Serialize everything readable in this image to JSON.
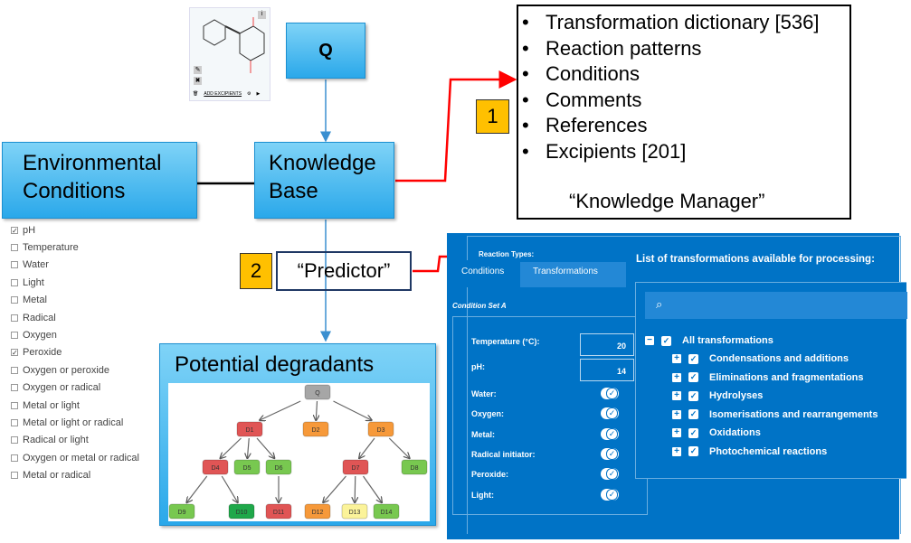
{
  "molecule": {
    "add_excipients": "ADD EXCIPIENTS",
    "icons": [
      "info-icon",
      "edit-icon",
      "close-icon",
      "trash-icon",
      "gear-icon",
      "play-icon"
    ]
  },
  "nodes": {
    "q": "Q",
    "env": "Environmental Conditions",
    "kb": "Knowledge Base",
    "predictor": "“Predictor”",
    "degradants": "Potential degradants"
  },
  "tags": {
    "one": "1",
    "two": "2"
  },
  "knowledge_manager": {
    "items": [
      "Transformation dictionary [536]",
      "Reaction patterns",
      "Conditions",
      "Comments",
      "References",
      "Excipients [201]"
    ],
    "caption": "“Knowledge Manager”"
  },
  "conditions_list": [
    {
      "label": "pH",
      "checked": true
    },
    {
      "label": "Temperature",
      "checked": false
    },
    {
      "label": "Water",
      "checked": false
    },
    {
      "label": "Light",
      "checked": false
    },
    {
      "label": "Metal",
      "checked": false
    },
    {
      "label": "Radical",
      "checked": false
    },
    {
      "label": "Oxygen",
      "checked": false
    },
    {
      "label": "Peroxide",
      "checked": true
    },
    {
      "label": "Oxygen or peroxide",
      "checked": false
    },
    {
      "label": "Oxygen or radical",
      "checked": false
    },
    {
      "label": "Metal or light",
      "checked": false
    },
    {
      "label": "Metal or light or radical",
      "checked": false
    },
    {
      "label": "Radical or light",
      "checked": false
    },
    {
      "label": "Oxygen or metal or radical",
      "checked": false
    },
    {
      "label": "Metal or radical",
      "checked": false
    }
  ],
  "tree": {
    "nodes": [
      {
        "id": "Q",
        "color": "#a6a6a6",
        "parent": null
      },
      {
        "id": "D1",
        "color": "#e05555",
        "parent": "Q"
      },
      {
        "id": "D2",
        "color": "#f6993a",
        "parent": "Q"
      },
      {
        "id": "D3",
        "color": "#f6993a",
        "parent": "Q"
      },
      {
        "id": "D4",
        "color": "#e05555",
        "parent": "D1"
      },
      {
        "id": "D5",
        "color": "#78c850",
        "parent": "D1"
      },
      {
        "id": "D6",
        "color": "#78c850",
        "parent": "D1"
      },
      {
        "id": "D7",
        "color": "#e05555",
        "parent": "D3"
      },
      {
        "id": "D8",
        "color": "#78c850",
        "parent": "D3"
      },
      {
        "id": "D9",
        "color": "#78c850",
        "parent": "D4"
      },
      {
        "id": "D10",
        "color": "#1fa84a",
        "parent": "D4"
      },
      {
        "id": "D11",
        "color": "#e05555",
        "parent": "D6"
      },
      {
        "id": "D12",
        "color": "#f6993a",
        "parent": "D7"
      },
      {
        "id": "D13",
        "color": "#fbf39a",
        "parent": "D7"
      },
      {
        "id": "D14",
        "color": "#78c850",
        "parent": "D7"
      }
    ]
  },
  "predictor_ui": {
    "reaction_types": "Reaction Types:",
    "tabs": [
      "Conditions",
      "Transformations"
    ],
    "condition_set": "Condition Set A",
    "temperature_label": "Temperature (°C):",
    "temperature": "20",
    "ph_label": "pH:",
    "ph": "14",
    "toggles": [
      {
        "label": "Water:",
        "on": true
      },
      {
        "label": "Oxygen:",
        "on": true
      },
      {
        "label": "Metal:",
        "on": true
      },
      {
        "label": "Radical initiator:",
        "on": true
      },
      {
        "label": "Peroxide:",
        "on": true
      },
      {
        "label": "Light:",
        "on": true
      }
    ],
    "list_title": "List of transformations available for processing:",
    "search_placeholder": "",
    "all": "All transformations",
    "transformations": [
      "Condensations and additions",
      "Eliminations and fragmentations",
      "Hydrolyses",
      "Isomerisations and rearrangements",
      "Oxidations",
      "Photochemical reactions"
    ]
  },
  "colors": {
    "accent_red": "#ff0000",
    "tag_yellow": "#ffc000",
    "panel_blue": "#0073c6"
  }
}
